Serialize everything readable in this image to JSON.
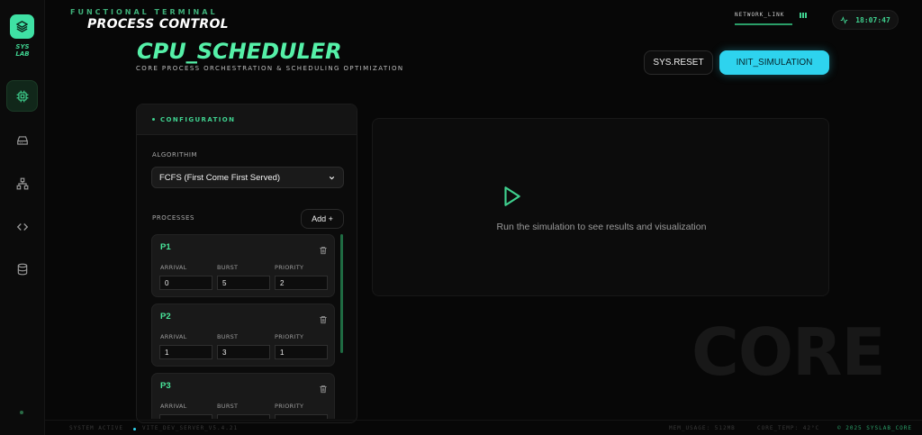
{
  "sidebar": {
    "logo_text_line1": "SYS",
    "logo_text_line2": "LAB",
    "items": [
      {
        "icon": "cpu-icon",
        "active": true
      },
      {
        "icon": "drive-icon",
        "active": false
      },
      {
        "icon": "network-icon",
        "active": false
      },
      {
        "icon": "code-icon",
        "active": false
      },
      {
        "icon": "database-icon",
        "active": false
      }
    ]
  },
  "header": {
    "subtitle": "FUNCTIONAL TERMINAL",
    "title": "PROCESS CONTROL",
    "network_label": "NETWORK_LINK",
    "clock": "18:07:47"
  },
  "page": {
    "title": "CPU_SCHEDULER",
    "subtitle": "CORE PROCESS ORCHESTRATION & SCHEDULING OPTIMIZATION",
    "reset_label": "SYS.RESET",
    "init_label": "INIT_SIMULATION"
  },
  "config": {
    "title": "CONFIGURATION",
    "algorithm_label": "ALGORITHIM",
    "algorithm_value": "FCFS (First Come First Served)",
    "processes_label": "PROCESSES",
    "add_label": "Add +",
    "field_labels": {
      "arrival": "ARRIVAL",
      "burst": "BURST",
      "priority": "PRIORITY"
    },
    "processes": [
      {
        "name": "P1",
        "arrival": "0",
        "burst": "5",
        "priority": "2"
      },
      {
        "name": "P2",
        "arrival": "1",
        "burst": "3",
        "priority": "1"
      },
      {
        "name": "P3",
        "arrival": "",
        "burst": "",
        "priority": ""
      }
    ]
  },
  "results": {
    "message": "Run the simulation to see results and visualization"
  },
  "watermark": "CORE",
  "footer": {
    "status": "SYSTEM ACTIVE",
    "server": "VITE_DEV_SERVER_V5.4.21",
    "mem": "MEM_USAGE: 512MB",
    "temp": "CORE_TEMP: 42°C",
    "copyright": "© 2025 SYSLAB_CORE"
  },
  "colors": {
    "accent_green": "#55f0a8",
    "accent_cyan": "#2ed3ee",
    "background": "#070707"
  }
}
